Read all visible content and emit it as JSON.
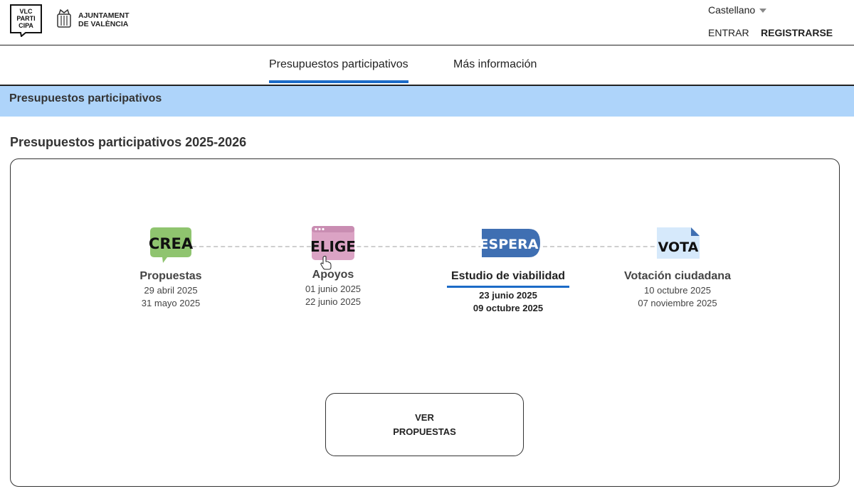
{
  "header": {
    "logo_vlc_lines": [
      "VLC",
      "PARTI",
      "CIPA"
    ],
    "logo_ajt_lines": [
      "AJUNTAMENT",
      "DE VALÈNCIA"
    ],
    "language": "Castellano",
    "entrar": "ENTRAR",
    "registrarse": "REGISTRARSE"
  },
  "nav": {
    "tabs": [
      {
        "label": "Presupuestos participativos",
        "active": true
      },
      {
        "label": "Más información",
        "active": false
      }
    ]
  },
  "banner": {
    "title": "Presupuestos participativos"
  },
  "section": {
    "title": "Presupuestos participativos 2025-2026"
  },
  "phases": [
    {
      "badge": "CREA",
      "label": "Propuestas",
      "start": "29 abril 2025",
      "end": "31 mayo 2025",
      "color": "#8fc46f"
    },
    {
      "badge": "ELIGE",
      "label": "Apoyos",
      "start": "01 junio 2025",
      "end": "22 junio 2025",
      "color": "#dba3c4"
    },
    {
      "badge": "ESPERA",
      "label": "Estudio de viabilidad",
      "start": "23 junio 2025",
      "end": "09 octubre 2025",
      "color": "#3f6fb2",
      "active": true
    },
    {
      "badge": "VOTA",
      "label": "Votación ciudadana",
      "start": "10 octubre 2025",
      "end": "07 noviembre 2025",
      "color": "#d6e9fb"
    }
  ],
  "cta": {
    "line1": "VER",
    "line2": "PROPUESTAS"
  },
  "colors": {
    "accent": "#1c6bc7",
    "banner": "#aed4fa"
  }
}
